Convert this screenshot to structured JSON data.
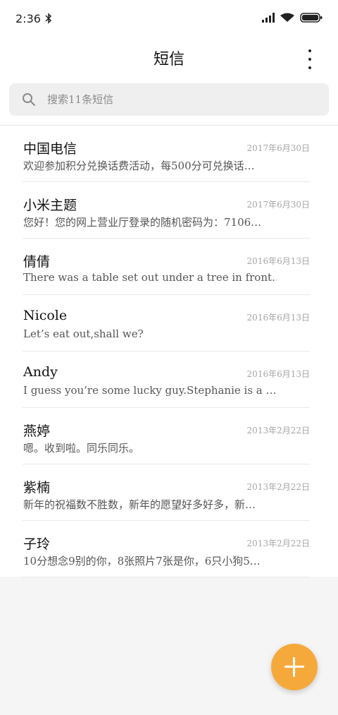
{
  "status_bar": {
    "time": "2:36",
    "icons": [
      "bluetooth-icon",
      "signal-icon",
      "wifi-icon",
      "battery-icon"
    ]
  },
  "header": {
    "title": "短信",
    "more_icon": "more-vertical-icon"
  },
  "search": {
    "placeholder": "搜索11条短信",
    "value": ""
  },
  "messages": [
    {
      "name": "中国电信",
      "date": "2017年6月30日",
      "preview": "欢迎参加积分兑换话费活动，每500分可兑换话…"
    },
    {
      "name": "小米主题",
      "date": "2017年6月30日",
      "preview": "您好！您的网上营业厅登录的随机密码为：7106…"
    },
    {
      "name": "倩倩",
      "date": "2016年6月13日",
      "preview": "There was a table set out under a tree in front…"
    },
    {
      "name": "Nicole",
      "date": "2016年6月13日",
      "preview": "Let’s eat out,shall we?"
    },
    {
      "name": "Andy",
      "date": "2016年6月13日",
      "preview": "I guess you’re some lucky guy.Stephanie is a …"
    },
    {
      "name": "燕婷",
      "date": "2013年2月22日",
      "preview": "嗯。收到啦。同乐同乐。"
    },
    {
      "name": "紫楠",
      "date": "2013年2月22日",
      "preview": "新年的祝福数不胜数，新年的愿望好多好多，新…"
    },
    {
      "name": "子玲",
      "date": "2013年2月22日",
      "preview": "10分想念9别的你，8张照片7张是你，6只小狗5…"
    }
  ],
  "fab": {
    "icon": "plus-icon",
    "color": "#f6a93b"
  },
  "colors": {
    "accent": "#f6a93b",
    "background": "#f5f5f5",
    "surface": "#ffffff"
  }
}
